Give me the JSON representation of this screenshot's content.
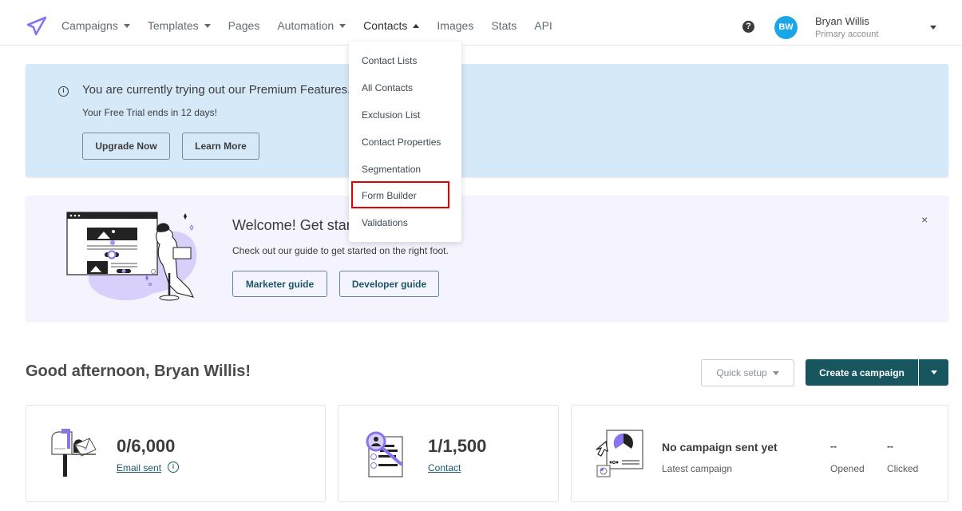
{
  "nav": {
    "logo_icon": "paper-plane-icon",
    "items": [
      {
        "label": "Campaigns",
        "has_caret": true
      },
      {
        "label": "Templates",
        "has_caret": true
      },
      {
        "label": "Pages",
        "has_caret": false
      },
      {
        "label": "Automation",
        "has_caret": true
      },
      {
        "label": "Contacts",
        "has_caret": true,
        "active": true
      },
      {
        "label": "Images",
        "has_caret": false
      },
      {
        "label": "Stats",
        "has_caret": false
      },
      {
        "label": "API",
        "has_caret": false
      }
    ],
    "help_icon": "?",
    "user": {
      "initials": "BW",
      "name": "Bryan Willis",
      "subtitle": "Primary account"
    }
  },
  "contacts_menu": {
    "items": [
      "Contact Lists",
      "All Contacts",
      "Exclusion List",
      "Contact Properties",
      "Segmentation",
      "Form Builder",
      "Validations"
    ],
    "highlighted": "Form Builder"
  },
  "trial_banner": {
    "info_icon": "i",
    "title": "You are currently trying out our Premium Features.",
    "subtitle": "Your Free Trial ends in 12 days!",
    "upgrade_label": "Upgrade Now",
    "learn_label": "Learn More"
  },
  "welcome_banner": {
    "title": "Welcome! Get started",
    "subtitle": "Check out our guide to get started on the right foot.",
    "marketer_label": "Marketer guide",
    "developer_label": "Developer guide",
    "close_label": "×"
  },
  "greeting": {
    "text": "Good afternoon, Bryan Willis!",
    "quick_setup_label": "Quick setup",
    "create_label": "Create a campaign"
  },
  "stats": {
    "emails": {
      "value": "0/6,000",
      "label": "Email sent",
      "info_icon": "i"
    },
    "contacts": {
      "value": "1/1,500",
      "label": "Contact"
    },
    "campaign": {
      "title": "No campaign sent yet",
      "subtitle": "Latest campaign",
      "opened_value": "--",
      "opened_label": "Opened",
      "clicked_value": "--",
      "clicked_label": "Clicked"
    }
  },
  "colors": {
    "accent_purple": "#8b73f0",
    "primary_teal": "#17555f",
    "avatar_blue": "#1ba6e8",
    "trial_bg": "#d6e9f9",
    "welcome_bg": "#f5f3fe",
    "highlight_red": "#e00000"
  }
}
